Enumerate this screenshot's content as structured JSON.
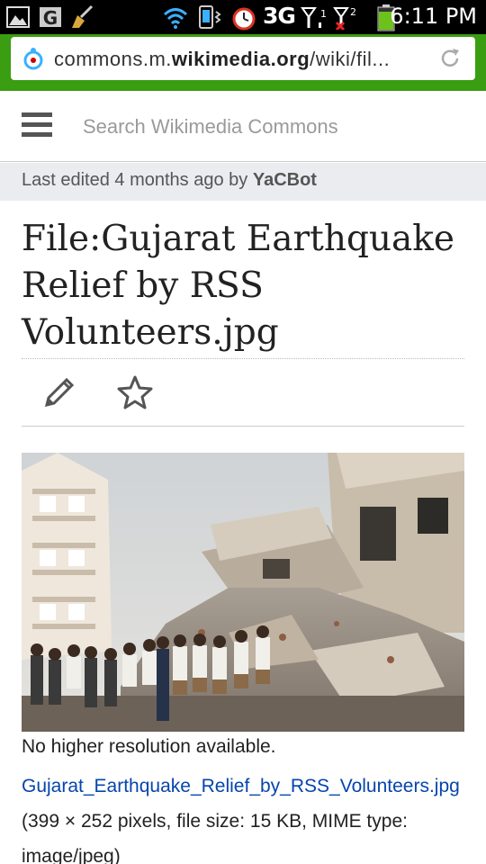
{
  "status_bar": {
    "network_label": "3G",
    "time": "6:11 PM",
    "icons": [
      "gallery-icon",
      "g-icon",
      "broom-icon",
      "wifi-icon",
      "vibrate-icon",
      "alarm-icon",
      "signal-icon",
      "signal-2-icon",
      "battery-icon"
    ]
  },
  "browser": {
    "url_prefix": "commons.m.",
    "url_domain": "wikimedia.org",
    "url_suffix": "/wiki/fil...",
    "accent_color": "#3a9d12"
  },
  "header": {
    "search_placeholder": "Search Wikimedia Commons"
  },
  "last_edited": {
    "text": "Last edited 4 months ago by",
    "user": "YaCBot"
  },
  "page": {
    "title": "File:Gujarat Earthquake Relief by RSS Volunteers.jpg",
    "no_higher_resolution": "No higher resolution available.",
    "file_link": "Gujarat_Earthquake_Relief_by_RSS_Volunteers.jpg",
    "file_details": " (399 × 252 pixels, file size: 15 KB, MIME type: image/jpeg)"
  },
  "actions": {
    "edit_icon": "pencil-icon",
    "watch_icon": "star-icon"
  }
}
